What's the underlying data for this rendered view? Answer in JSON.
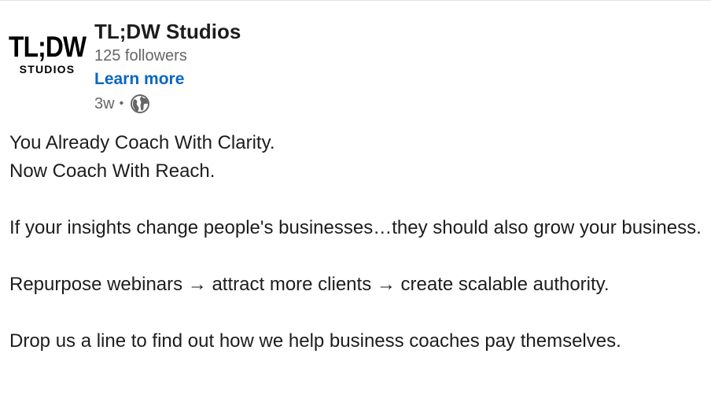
{
  "post": {
    "author": {
      "logo_main": "TL;DW",
      "logo_sub": "STUDIOS",
      "name": "TL;DW Studios",
      "followers": "125 followers",
      "cta": "Learn more",
      "time": "3w",
      "separator": "•",
      "visibility_icon": "globe-icon"
    },
    "body": {
      "line1": "You Already Coach With Clarity.",
      "line2": "Now Coach With Reach.",
      "paragraph2": "If your insights change people's businesses…they should also grow your business.",
      "paragraph3": "Repurpose webinars → attract more clients → create scalable authority.",
      "paragraph4": "Drop us a line to find out how we help business coaches pay themselves."
    }
  },
  "colors": {
    "link": "#0a66c2",
    "secondary_text": "#666666",
    "primary_text": "#1d1d1d"
  }
}
